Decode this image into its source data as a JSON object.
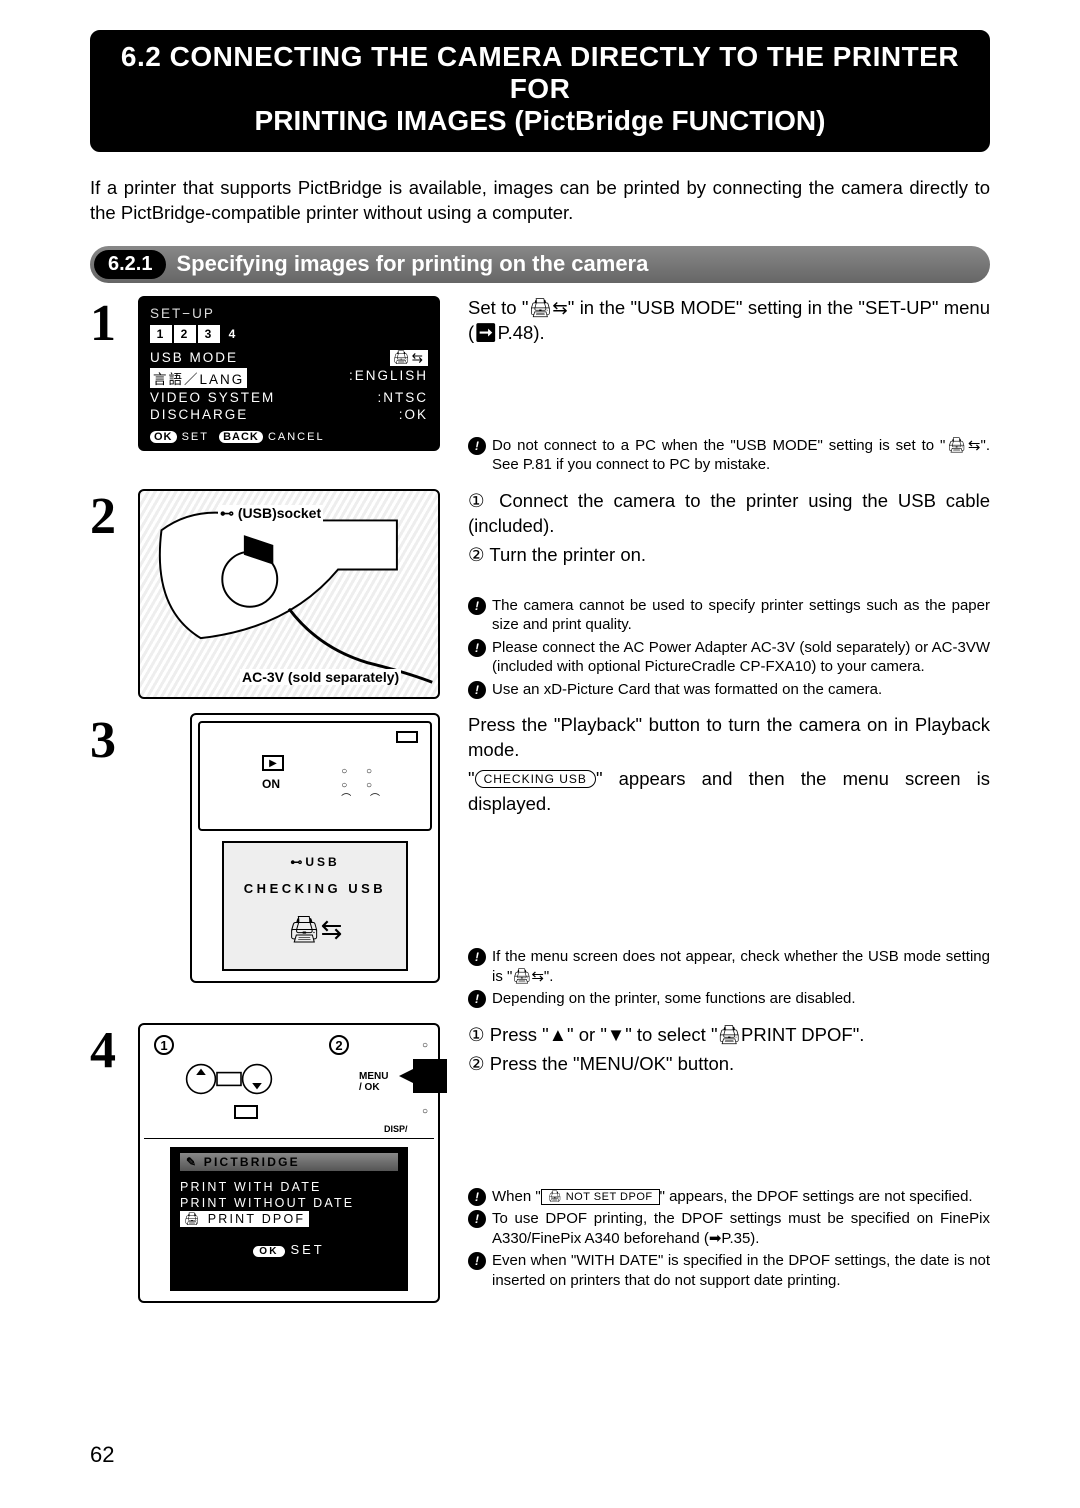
{
  "page_number": "62",
  "title": {
    "line1": "6.2 CONNECTING THE CAMERA DIRECTLY TO THE PRINTER FOR",
    "line2": "PRINTING IMAGES (PictBridge FUNCTION)"
  },
  "intro": "If a printer that supports PictBridge is available, images can be printed by connecting the camera directly to the PictBridge-compatible printer without using a computer.",
  "section": {
    "num": "6.2.1",
    "label": "Specifying images for printing on the camera"
  },
  "steps": {
    "s1": {
      "num": "1",
      "lcd": {
        "header": "SET−UP",
        "tabs": [
          "1",
          "2",
          "3",
          "4"
        ],
        "rows": [
          {
            "k": "USB MODE",
            "v": "🖨⇆",
            "hl": "v"
          },
          {
            "k": "言語／LANG",
            "v": ":ENGLISH",
            "hl": "k"
          },
          {
            "k": "VIDEO SYSTEM",
            "v": ":NTSC"
          },
          {
            "k": "DISCHARGE",
            "v": ":OK"
          }
        ],
        "footer": {
          "ok": "OK",
          "set": "SET",
          "back": "BACK",
          "cancel": "CANCEL"
        }
      },
      "instr": "Set to \"🖨⇆\" in the \"USB MODE\" setting in the \"SET-UP\" menu (➡P.48).",
      "notes": [
        "Do not connect to a PC when the \"USB MODE\" setting is set to \"🖨⇆\". See P.81 if you connect to PC by mistake."
      ]
    },
    "s2": {
      "num": "2",
      "labels": {
        "usb_socket": "(USB)socket",
        "ac3v": "AC-3V (sold separately)"
      },
      "instr": [
        "① Connect the camera to the printer using the USB cable (included).",
        "② Turn the printer on."
      ],
      "notes": [
        "The camera cannot be used to specify printer settings such as the paper size and print quality.",
        "Please connect the AC Power Adapter AC-3V (sold separately) or AC-3VW (included with optional PictureCradle CP-FXA10) to your camera.",
        "Use an xD-Picture Card that was formatted on the camera."
      ]
    },
    "s3": {
      "num": "3",
      "fig": {
        "on_label": "ON",
        "usb_label": "USB",
        "checking": "CHECKING USB"
      },
      "instr_a": "Press the \"Playback\" button to turn the camera on in Playback mode.",
      "instr_b_prefix": "\"",
      "instr_b_pill": "CHECKING USB",
      "instr_b_suffix": "\" appears and then the menu screen is displayed.",
      "notes": [
        "If the menu screen does not appear, check whether the USB mode setting is \"🖨⇆\".",
        "Depending on the printer, some functions are disabled."
      ]
    },
    "s4": {
      "num": "4",
      "fig": {
        "c1": "1",
        "c2": "2",
        "menu": "MENU\n/ OK",
        "disp": "DISP/",
        "lcd_header": "PICTBRIDGE",
        "items": [
          "PRINT WITH DATE",
          "PRINT WITHOUT DATE",
          "🖨 PRINT DPOF"
        ],
        "ok": "OK",
        "set": "SET"
      },
      "instr": [
        "① Press \"▲\" or \"▼\" to select \"🖨PRINT DPOF\".",
        "② Press the \"MENU/OK\" button."
      ],
      "notes_pre": "When \"",
      "notes_box": "🖨 NOT SET DPOF",
      "notes_post": "\" appears, the DPOF settings are not specified.",
      "notes": [
        "To use DPOF printing, the DPOF settings must be specified on FinePix A330/FinePix A340 beforehand (➡P.35).",
        "Even when \"WITH DATE\" is specified in the DPOF settings, the date is not inserted on printers that do not support date printing."
      ]
    }
  }
}
